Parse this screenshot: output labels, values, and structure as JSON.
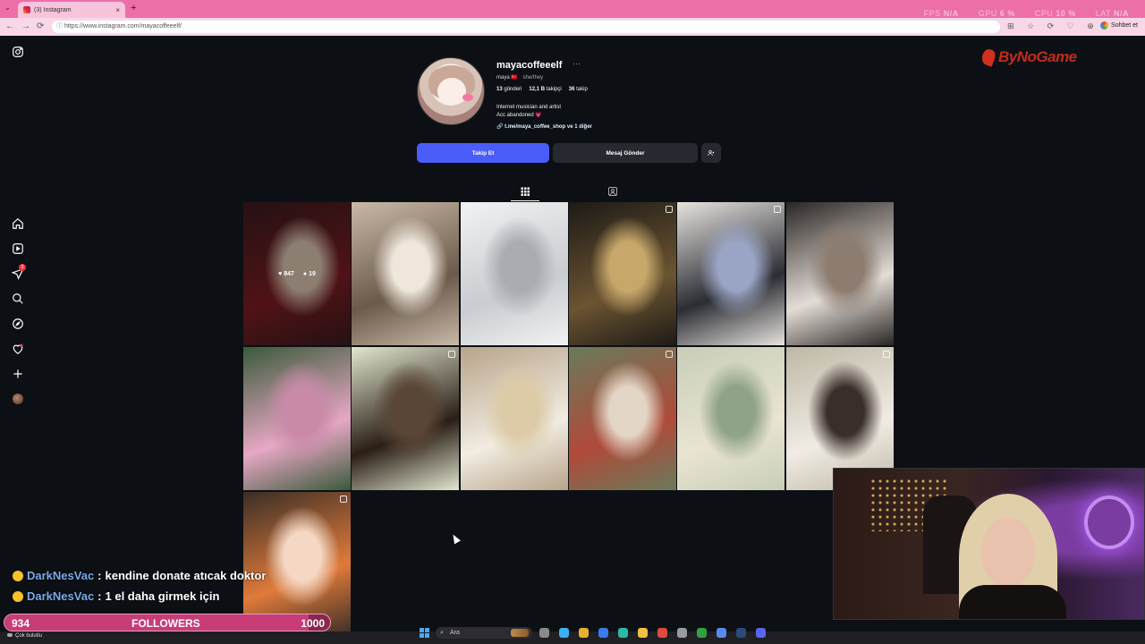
{
  "browser": {
    "tab_title": "(3) Instagram",
    "url": "https://www.instagram.com/mayacoffeeelf/",
    "chat_button": "Sohbet et",
    "new_tab": "+",
    "tab_dropdown": "⌄",
    "tab_close": "×",
    "window_controls": "— ❐ ✕",
    "nav": {
      "back": "←",
      "forward": "→",
      "reload": "⟳"
    },
    "toolbar_icons": "⊞ ☆ ⟳ ♡ ⊕"
  },
  "overlay_stats": {
    "fps_label": "FPS",
    "fps_value": "N/A",
    "gpu_label": "GPU",
    "gpu_value": "6 %",
    "cpu_label": "CPU",
    "cpu_value": "10 %",
    "lat_label": "LAT",
    "lat_value": "N/A"
  },
  "brand_logo": "ByNoGame",
  "sidebar": {
    "items": [
      {
        "name": "instagram-logo-icon"
      },
      {
        "name": "home-icon"
      },
      {
        "name": "reels-icon"
      },
      {
        "name": "direct-icon",
        "badge": "3"
      },
      {
        "name": "search-icon"
      },
      {
        "name": "explore-icon"
      },
      {
        "name": "notifications-icon"
      },
      {
        "name": "create-icon"
      },
      {
        "name": "profile-avatar"
      }
    ]
  },
  "profile": {
    "username": "mayacoffeeelf",
    "more": "···",
    "display_name": "maya",
    "name_emoji": "🇹🇷",
    "pronouns": "she/they",
    "posts_count": "13",
    "posts_label": "gönderi",
    "followers_count": "12,1 B",
    "followers_label": "takipçi",
    "following_count": "36",
    "following_label": "takip",
    "bio_line1": "Internet musician and artist",
    "bio_line2": "Acc abandoned",
    "bio_heart": "💗",
    "link": "t.me/maya_coffee_shop ve 1 diğer",
    "follow_button": "Takip Et",
    "message_button": "Mesaj Gönder",
    "add_person_button": "+",
    "link_icon": "🔗"
  },
  "hover_stats": {
    "likes": "847",
    "comments": "19"
  },
  "posts": [
    {
      "colors": [
        "#3a1b1e",
        "#7b1c22",
        "#d9c2b0"
      ],
      "hover": true
    },
    {
      "colors": [
        "#c9b9a8",
        "#6b5a4a",
        "#efe6dc"
      ],
      "multi": false
    },
    {
      "colors": [
        "#f1f2f3",
        "#c9ccd0",
        "#a9adb2"
      ],
      "multi": false
    },
    {
      "colors": [
        "#1d1a16",
        "#6b5431",
        "#c7a86a"
      ],
      "multi": true
    },
    {
      "colors": [
        "#e7e3de",
        "#2b2d34",
        "#9aa4c4"
      ],
      "multi": true
    },
    {
      "colors": [
        "#2a2624",
        "#e3ddd6",
        "#8d7c70"
      ],
      "multi": false
    },
    {
      "colors": [
        "#3a5a3a",
        "#e7a8c4",
        "#c98aa8"
      ],
      "multi": false
    },
    {
      "colors": [
        "#e2e6d0",
        "#2a1e16",
        "#5a4636"
      ],
      "multi": true
    },
    {
      "colors": [
        "#b8a48a",
        "#f2ece2",
        "#dccba6"
      ],
      "multi": false
    },
    {
      "colors": [
        "#6a7a5a",
        "#b04a3a",
        "#e4d6c6"
      ],
      "multi": true
    },
    {
      "colors": [
        "#c8ceb8",
        "#e9e4d2",
        "#8fa28a"
      ],
      "multi": false
    },
    {
      "colors": [
        "#bfb8a6",
        "#f0ece4",
        "#3a2e2a"
      ],
      "multi": true
    },
    {
      "colors": [
        "#3a2e26",
        "#e07a3a",
        "#f4d8c4"
      ],
      "multi": true
    }
  ],
  "chat": [
    {
      "user": "DarkNesVac",
      "sep": " : ",
      "message": "kendine donate atıcak doktor"
    },
    {
      "user": "DarkNesVac",
      "sep": " : ",
      "message": "1 el daha girmek için"
    }
  ],
  "followers_goal": {
    "current": "934",
    "label": "FOLLOWERS",
    "target": "1000",
    "progress": 0.934
  },
  "taskbar": {
    "weather": "Çok bulutlu",
    "search_placeholder": "Ara",
    "search_icon": "⌕",
    "apps": [
      "widgets",
      "copilot",
      "file-explorer",
      "store",
      "edge",
      "folder",
      "chrome",
      "settings",
      "xbox",
      "vpn",
      "steam",
      "discord"
    ]
  },
  "colors": {
    "accent_blue": "#4a5df9",
    "tab_pink": "#ec6fa8",
    "brand_red": "#c42b1c",
    "follower_bar": "#c83c78"
  }
}
